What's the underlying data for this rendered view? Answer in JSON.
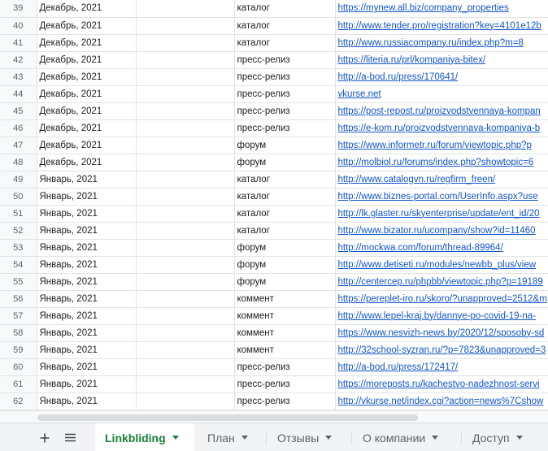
{
  "rows": [
    {
      "num": "39",
      "date": "Декабрь, 2021",
      "type": "каталог",
      "url": "https://mynew.all.biz/company_properties"
    },
    {
      "num": "40",
      "date": "Декабрь, 2021",
      "type": "каталог",
      "url": "http://www.tender.pro/registration?key=4101e12b"
    },
    {
      "num": "41",
      "date": "Декабрь, 2021",
      "type": "каталог",
      "url": "http://www.russiacompany.ru/index.php?m=8"
    },
    {
      "num": "42",
      "date": "Декабрь, 2021",
      "type": "пресс-релиз",
      "url": "https://literia.ru/prl/kompaniya-bitex/"
    },
    {
      "num": "43",
      "date": "Декабрь, 2021",
      "type": "пресс-релиз",
      "url": "http://a-bod.ru/press/170641/"
    },
    {
      "num": "44",
      "date": "Декабрь, 2021",
      "type": "пресс-релиз",
      "url": "vkurse.net"
    },
    {
      "num": "45",
      "date": "Декабрь, 2021",
      "type": "пресс-релиз",
      "url": "https://post-repost.ru/proizvodstvennaya-kompan"
    },
    {
      "num": "46",
      "date": "Декабрь, 2021",
      "type": "пресс-релиз",
      "url": "https://e-kom.ru/proizvodstvennaya-kompaniya-b"
    },
    {
      "num": "47",
      "date": "Декабрь, 2021",
      "type": "форум",
      "url": "https://www.informetr.ru/forum/viewtopic.php?p"
    },
    {
      "num": "48",
      "date": "Декабрь, 2021",
      "type": "форум",
      "url": "http://molbiol.ru/forums/index.php?showtopic=6"
    },
    {
      "num": "49",
      "date": "Январь, 2021",
      "type": "каталог",
      "url": "http://www.catalogvn.ru/regfirm_freen/"
    },
    {
      "num": "50",
      "date": "Январь, 2021",
      "type": "каталог",
      "url": "http://www.biznes-portal.com/UserInfo.aspx?use"
    },
    {
      "num": "51",
      "date": "Январь, 2021",
      "type": "каталог",
      "url": "http://lk.glaster.ru/skyenterprise/update/ent_id/20"
    },
    {
      "num": "52",
      "date": "Январь, 2021",
      "type": "каталог",
      "url": "http://www.bizator.ru/ucompany/show?id=11460"
    },
    {
      "num": "53",
      "date": "Январь, 2021",
      "type": "форум",
      "url": "http://mockwa.com/forum/thread-89964/"
    },
    {
      "num": "54",
      "date": "Январь, 2021",
      "type": "форум",
      "url": "http://www.detiseti.ru/modules/newbb_plus/view"
    },
    {
      "num": "55",
      "date": "Январь, 2021",
      "type": "форум",
      "url": "http://centercep.ru/phpbb/viewtopic.php?p=19189"
    },
    {
      "num": "56",
      "date": "Январь, 2021",
      "type": "коммент",
      "url": "https://pereplet-iro.ru/skoro/?unapproved=2512&m"
    },
    {
      "num": "57",
      "date": "Январь, 2021",
      "type": "коммент",
      "url": "http://www.lepel-kraj.by/dannye-po-covid-19-na-"
    },
    {
      "num": "58",
      "date": "Январь, 2021",
      "type": "коммент",
      "url": "https://www.nesvizh-news.by/2020/12/sposoby-sd"
    },
    {
      "num": "59",
      "date": "Январь, 2021",
      "type": "коммент",
      "url": "http://32school-syzran.ru/?p=7823&unapproved=3"
    },
    {
      "num": "60",
      "date": "Январь, 2021",
      "type": "пресс-релиз",
      "url": "http://a-bod.ru/press/172417/"
    },
    {
      "num": "61",
      "date": "Январь, 2021",
      "type": "пресс-релиз",
      "url": "https://moreposts.ru/kachestvo-nadezhnost-servi"
    },
    {
      "num": "62",
      "date": "Январь, 2021",
      "type": "пресс-релиз",
      "url": "http://vkurse.net/index.cgi?action=news%7Cshow"
    }
  ],
  "toolbar": {
    "add_icon": "plus-icon",
    "list_icon": "hamburger-icon"
  },
  "tabs": [
    {
      "label": "Linkbliding",
      "active": true
    },
    {
      "label": "План",
      "active": false
    },
    {
      "label": "Отзывы",
      "active": false
    },
    {
      "label": "О компании",
      "active": false
    },
    {
      "label": "Доступ",
      "active": false
    }
  ],
  "colors": {
    "active_tab": "#188038",
    "link": "#1155cc"
  }
}
